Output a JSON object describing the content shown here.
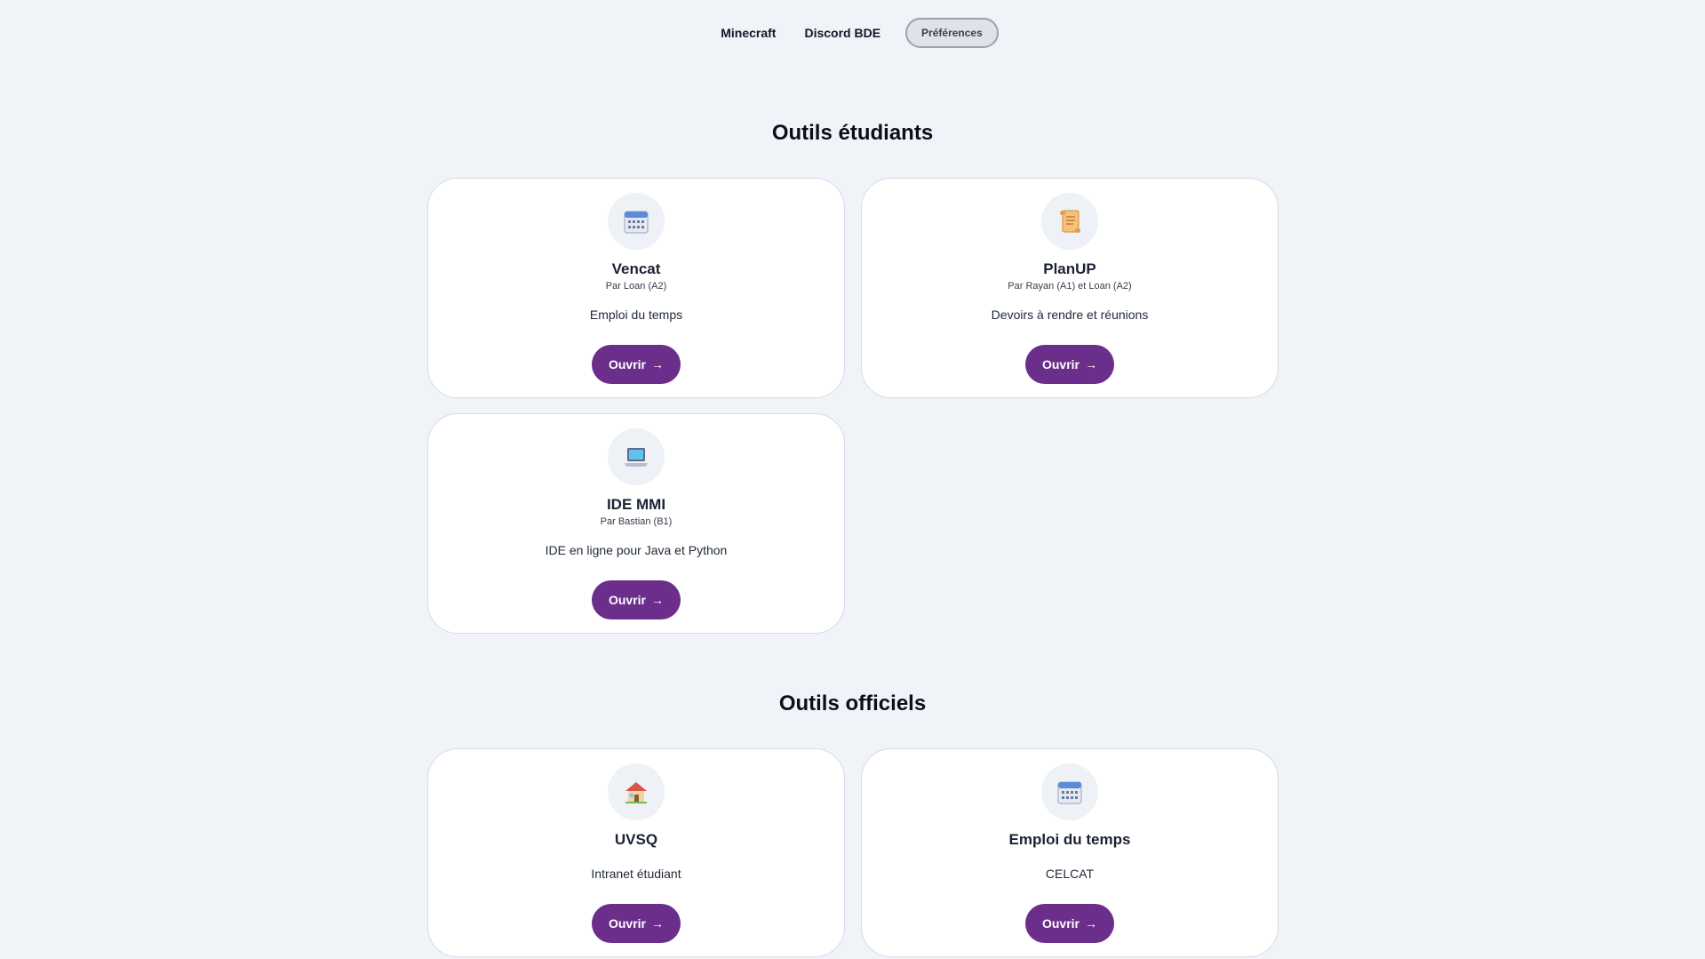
{
  "nav": {
    "links": [
      "Minecraft",
      "Discord BDE"
    ],
    "preferences_label": "Préférences"
  },
  "sections": [
    {
      "title": "Outils étudiants",
      "cards": [
        {
          "icon": "calendar-icon",
          "title": "Vencat",
          "author": "Par Loan (A2)",
          "description": "Emploi du temps",
          "button": "Ouvrir"
        },
        {
          "icon": "scroll-icon",
          "title": "PlanUP",
          "author": "Par Rayan (A1) et Loan (A2)",
          "description": "Devoirs à rendre et réunions",
          "button": "Ouvrir"
        },
        {
          "icon": "laptop-icon",
          "title": "IDE MMI",
          "author": "Par Bastian (B1)",
          "description": "IDE en ligne pour Java et Python",
          "button": "Ouvrir"
        }
      ]
    },
    {
      "title": "Outils officiels",
      "cards": [
        {
          "icon": "house-icon",
          "title": "UVSQ",
          "description": "Intranet étudiant",
          "button": "Ouvrir"
        },
        {
          "icon": "calendar-icon",
          "title": "Emploi du temps",
          "description": "CELCAT",
          "button": "Ouvrir"
        }
      ]
    }
  ],
  "colors": {
    "background": "#f0f3f8",
    "card": "#ffffff",
    "button": "#6b2e8b",
    "preferences_button": "#dfe3e8"
  }
}
